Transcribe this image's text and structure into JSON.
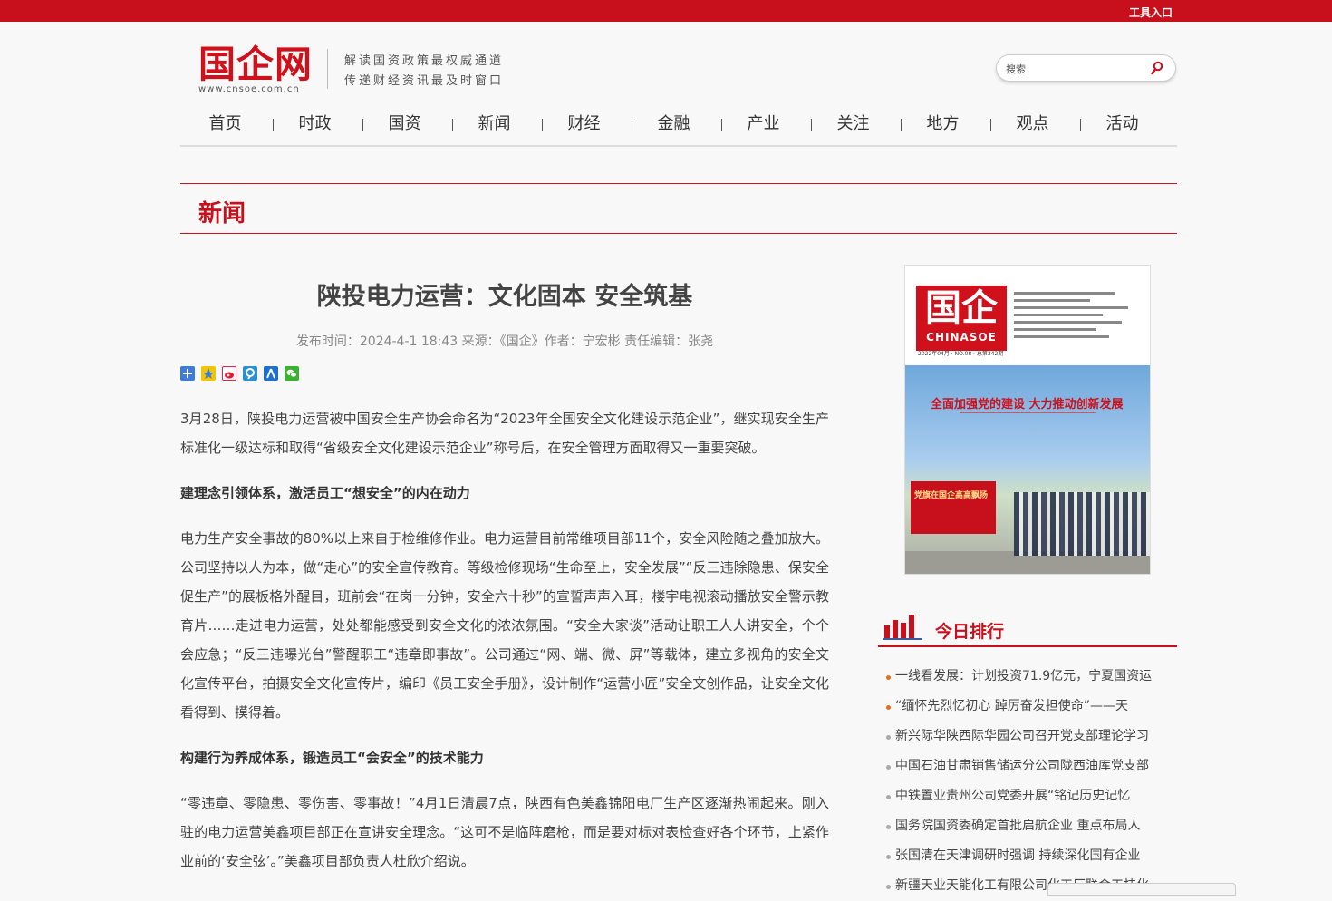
{
  "topbar": {
    "tools_link": "工具入口"
  },
  "logo": {
    "name": "国企网",
    "url": "www.cnsoe.com.cn"
  },
  "slogan": {
    "line1": "解读国资政策最权威通道",
    "line2": "传递财经资讯最及时窗口"
  },
  "search": {
    "placeholder": "搜索"
  },
  "nav": {
    "items": [
      "首页",
      "时政",
      "国资",
      "新闻",
      "财经",
      "金融",
      "产业",
      "关注",
      "地方",
      "观点",
      "活动"
    ]
  },
  "section": {
    "title": "新闻"
  },
  "article": {
    "title": "陕投电力运营：文化固本 安全筑基",
    "meta": "发布时间：2024-4-1 18:43 来源：《国企》作者：宁宏彬 责任编辑：张尧",
    "paragraphs": [
      "3月28日，陕投电力运营被中国安全生产协会命名为“2023年全国安全文化建设示范企业”，继实现安全生产标准化一级达标和取得“省级安全文化建设示范企业”称号后，在安全管理方面取得又一重要突破。",
      "建理念引领体系，激活员工“想安全”的内在动力",
      "电力生产安全事故的80%以上来自于检维修作业。电力运营目前常维项目部11个，安全风险随之叠加放大。公司坚持以人为本，做“走心”的安全宣传教育。等级检修现场“生命至上，安全发展”“反三违除隐患、保安全促生产”的展板格外醒目，班前会“在岗一分钟，安全六十秒”的宣誓声声入耳，楼宇电视滚动播放安全警示教育片……走进电力运营，处处都能感受到安全文化的浓浓氛围。“安全大家谈”活动让职工人人讲安全，个个会应急；“反三违曝光台”警醒职工“违章即事故”。公司通过“网、端、微、屏”等载体，建立多视角的安全文化宣传平台，拍摄安全文化宣传片，编印《员工安全手册》，设计制作“运营小匠”安全文创作品，让安全文化看得到、摸得着。",
      "构建行为养成体系，锻造员工“会安全”的技术能力",
      "“零违章、零隐患、零伤害、零事故！”4月1日清晨7点，陕西有色美鑫锦阳电厂生产区逐渐热闹起来。刚入驻的电力运营美鑫项目部正在宣讲安全理念。“这可不是临阵磨枪，而是要对标对表检查好各个环节，上紧作业前的‘安全弦’。”美鑫项目部负责人杜欣介绍说。"
    ]
  },
  "cover": {
    "brand": "国企",
    "brand_en": "CHINASOE",
    "issue": "2022年04月 · NO.08 · 总第342期",
    "headline": "全面加强党的建设 大力推动创新发展",
    "billboard": "党旗在国企高高飘扬"
  },
  "ranking": {
    "title": "今日排行",
    "items": [
      "一线看发展：计划投资71.9亿元，宁夏国资运",
      "“缅怀先烈忆初心 踔厉奋发担使命”——天",
      "新兴际华陕西际华园公司召开党支部理论学习",
      "中国石油甘肃销售储运分公司陇西油库党支部",
      "中铁置业贵州公司党委开展“铭记历史记忆",
      "国务院国资委确定首批启航企业 重点布局人",
      "张国清在天津调研时强调 持续深化国有企业",
      "新疆天业天能化工有限公司化工厂联合工技化"
    ]
  },
  "colors": {
    "brand_red": "#c8101c",
    "hot_dot": "#e07020"
  }
}
